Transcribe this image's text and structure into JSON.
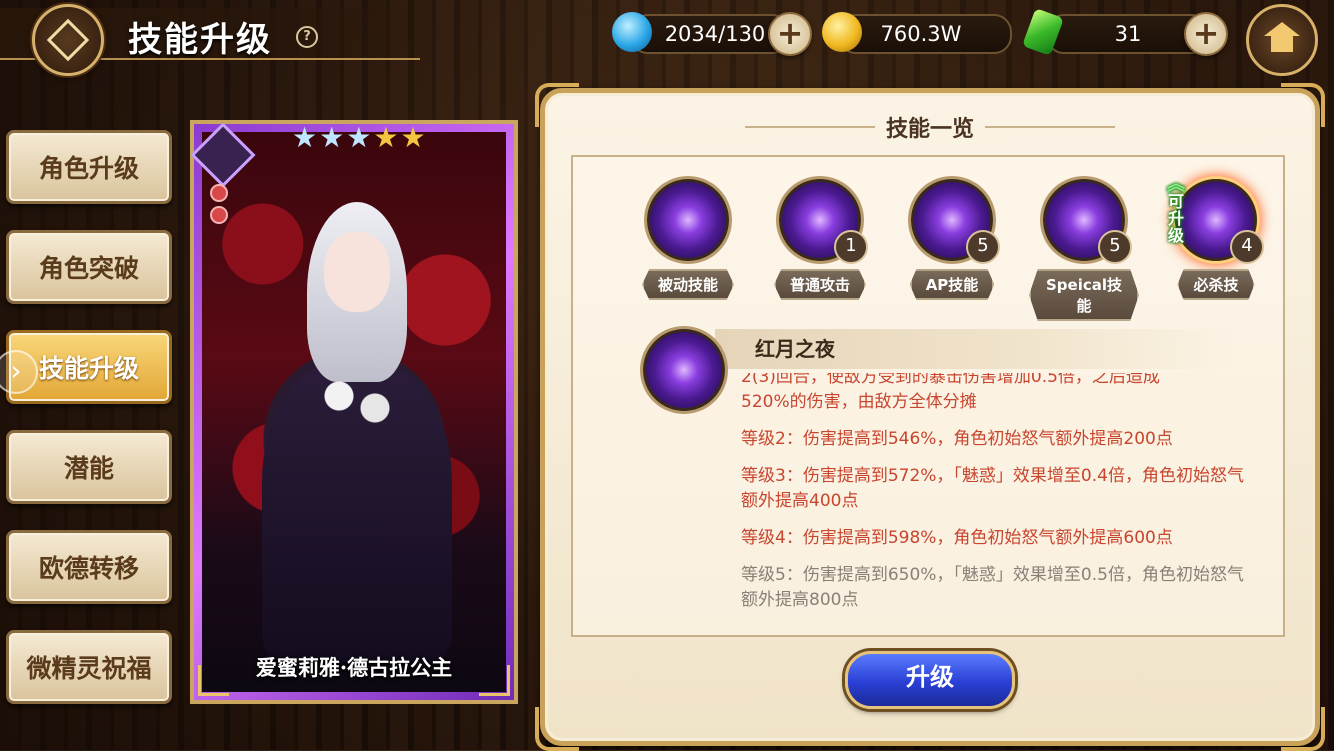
{
  "header": {
    "title": "技能升级",
    "help": "?"
  },
  "resources": {
    "stamina": "2034/130",
    "gold": "760.3W",
    "gems": "31"
  },
  "menu": {
    "items": [
      {
        "label": "角色升级"
      },
      {
        "label": "角色突破"
      },
      {
        "label": "技能升级"
      },
      {
        "label": "潜能"
      },
      {
        "label": "欧德转移"
      },
      {
        "label": "微精灵祝福"
      }
    ]
  },
  "character": {
    "name": "爱蜜莉雅·德古拉公主",
    "stars": 5
  },
  "panel": {
    "title": "技能一览",
    "skills": [
      {
        "label": "被动技能",
        "level": ""
      },
      {
        "label": "普通攻击",
        "level": "1"
      },
      {
        "label": "AP技能",
        "level": "5"
      },
      {
        "label": "Speical技能",
        "level": "5"
      },
      {
        "label": "必杀技",
        "level": "4",
        "upgrade_tag": "可升级"
      }
    ],
    "selected_skill_name": "红月之夜",
    "description": {
      "line0": "2(3)回合，使敌方受到的暴击伤害增加0.5倍，之后造成",
      "line1": "520%的伤害，由敌方全体分摊",
      "lvl2": "等级2：伤害提高到546%，角色初始怒气额外提高200点",
      "lvl3": "等级3：伤害提高到572%，「魅惑」效果增至0.4倍，角色初始怒气额外提高400点",
      "lvl4": "等级4：伤害提高到598%，角色初始怒气额外提高600点",
      "lvl5": "等级5：伤害提高到650%，「魅惑」效果增至0.5倍，角色初始怒气额外提高800点"
    },
    "upgrade_button": "升级"
  }
}
